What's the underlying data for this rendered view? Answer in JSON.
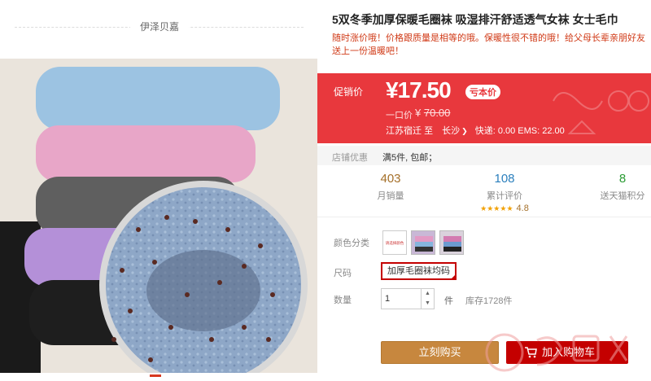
{
  "shop": {
    "name": "伊泽贝嘉"
  },
  "product": {
    "title": "5双冬季加厚保暖毛圈袜 吸湿排汗舒适透气女袜 女士毛巾",
    "subtitle": "随时涨价哦！价格跟质量是相等的哦。保暖性很不错的哦！给父母长辈亲朋好友送上一份温暖吧！"
  },
  "price": {
    "label": "促销价",
    "current": "¥17.50",
    "tag": "亏本价",
    "original_label": "一口价",
    "original_symbol": "¥",
    "original_value": "70.00",
    "origin": "江苏宿迁",
    "to": "至",
    "destination": "长沙",
    "shipping": "快递: 0.00 EMS: 22.00"
  },
  "promo": {
    "label": "店铺优惠",
    "text": "满5件, 包邮；"
  },
  "stats": [
    {
      "value": "403",
      "label": "月销量"
    },
    {
      "value": "108",
      "label": "累计评价",
      "stars": "★★★★★",
      "score": "4.8"
    },
    {
      "value": "8",
      "label": "送天猫积分"
    }
  ],
  "options": {
    "color_label": "颜色分类",
    "swatch1_text": "请选择颜色",
    "size_label": "尺码",
    "size_value": "加厚毛圈袜均码",
    "qty_label": "数量",
    "qty_value": "1",
    "qty_unit": "件",
    "stock": "库存1728件"
  },
  "buttons": {
    "buy": "立刻购买",
    "cart": "加入购物车"
  },
  "colors": {
    "accent": "#e8383d",
    "buy": "#c7873e",
    "cart": "#c40000"
  }
}
